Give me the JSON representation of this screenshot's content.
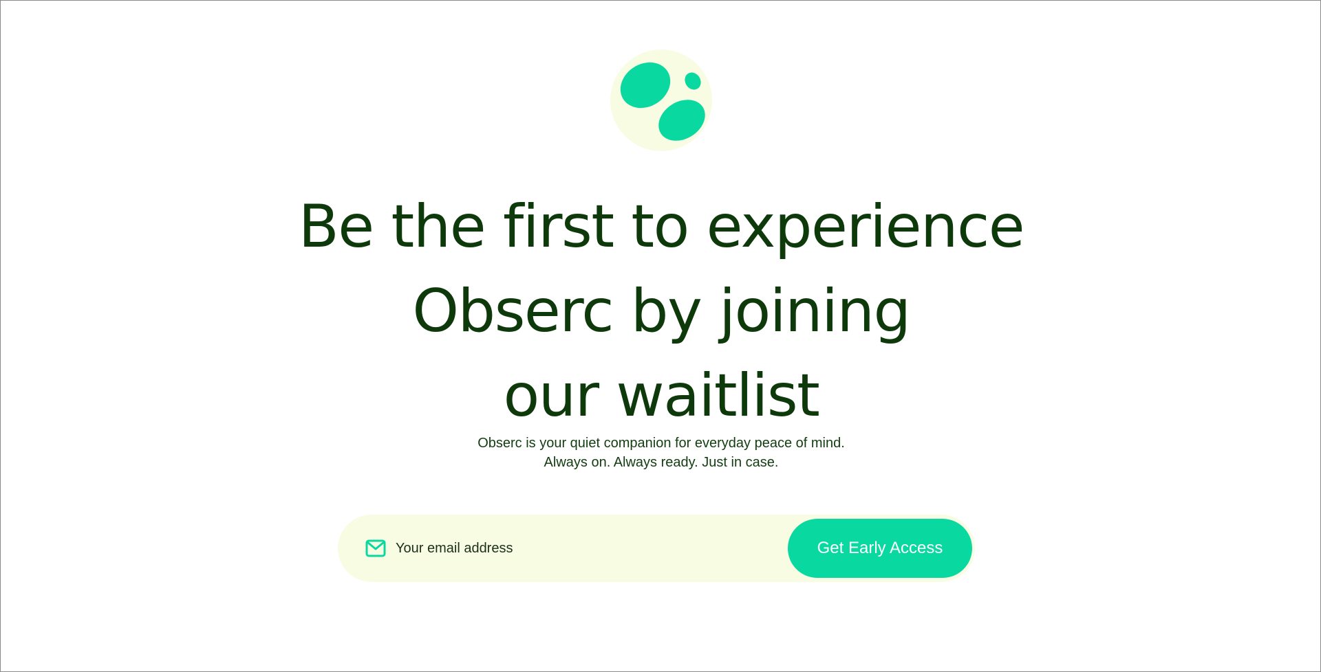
{
  "brand": {
    "logo_icon": "obserc-logo-icon",
    "logo_bg_color": "#f8fce3",
    "logo_shape_color": "#0ad8a1"
  },
  "hero": {
    "headline_lines": [
      "Be the first to experience",
      "Obserc by joining",
      "our waitlist"
    ],
    "subtext_lines": [
      "Obserc is your quiet companion for everyday peace of mind.",
      "Always on. Always ready. Just in case."
    ]
  },
  "signup": {
    "email_placeholder": "Your email address",
    "email_value": "",
    "mail_icon": "mail-icon",
    "button_label": "Get Early Access"
  },
  "colors": {
    "heading": "#0e3a0b",
    "accent": "#0ad8a1",
    "form_bg": "#f8fce3"
  }
}
